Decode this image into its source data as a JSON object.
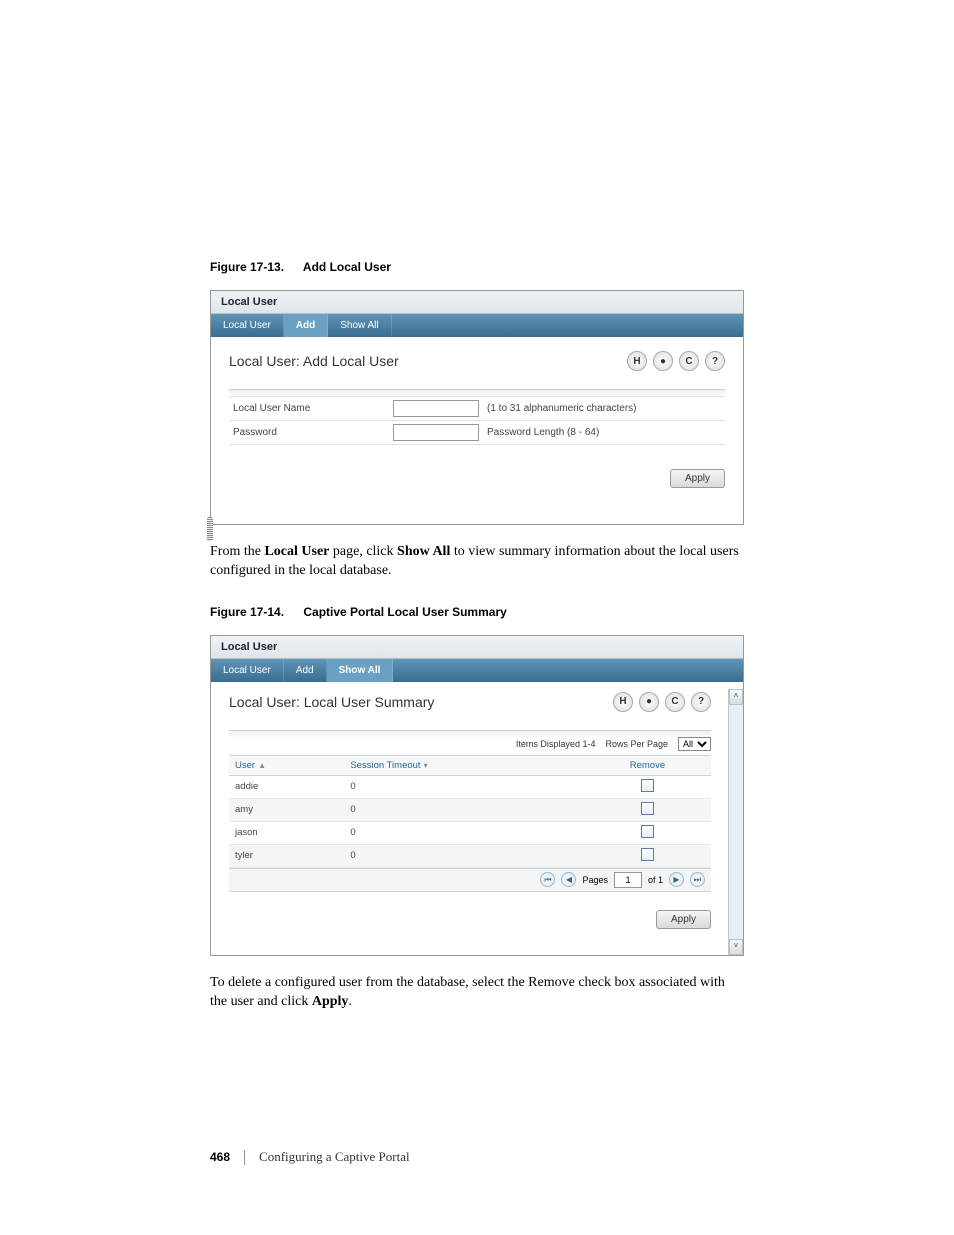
{
  "figure1": {
    "caption_num": "Figure 17-13.",
    "caption_title": "Add Local User",
    "panel_title": "Local User",
    "tabs": [
      "Local User",
      "Add",
      "Show All"
    ],
    "active_tab_index": 1,
    "heading": "Local User: Add Local User",
    "icons": [
      "H",
      "●",
      "C",
      "?"
    ],
    "rows": [
      {
        "label": "Local User Name",
        "hint": "(1 to 31 alphanumeric characters)"
      },
      {
        "label": "Password",
        "hint": "Password Length (8 - 64)"
      }
    ],
    "apply": "Apply"
  },
  "para1": {
    "pre": "From the ",
    "b1": "Local User",
    "mid": " page, click ",
    "b2": "Show All",
    "post": " to view summary information about the local users configured in the local database."
  },
  "figure2": {
    "caption_num": "Figure 17-14.",
    "caption_title": "Captive Portal Local User Summary",
    "panel_title": "Local User",
    "tabs": [
      "Local User",
      "Add",
      "Show All"
    ],
    "active_tab_index": 2,
    "heading": "Local User: Local User Summary",
    "icons": [
      "H",
      "●",
      "C",
      "?"
    ],
    "items_displayed_label": "Items Displayed 1-4",
    "rows_per_page_label": "Rows Per Page",
    "rows_per_page_value": "All",
    "columns": [
      "User",
      "Session Timeout",
      "Remove"
    ],
    "data": [
      {
        "user": "addie",
        "timeout": "0"
      },
      {
        "user": "amy",
        "timeout": "0"
      },
      {
        "user": "jason",
        "timeout": "0"
      },
      {
        "user": "tyler",
        "timeout": "0"
      }
    ],
    "pager": {
      "pages_label": "Pages",
      "current": "1",
      "of_label": "of 1"
    },
    "apply": "Apply"
  },
  "para2": {
    "pre": "To delete a configured user from the database, select the Remove check box associated with the user and click ",
    "b1": "Apply",
    "post": "."
  },
  "footer": {
    "page": "468",
    "chapter": "Configuring a Captive Portal"
  }
}
